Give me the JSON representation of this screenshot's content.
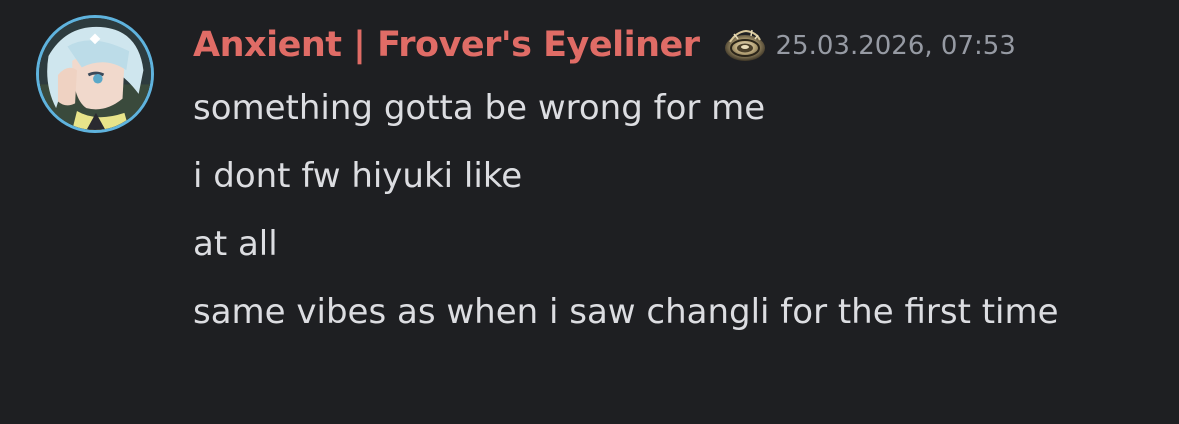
{
  "message": {
    "author": "Anxient | Frover's Eyeliner",
    "author_color": "#e06c66",
    "badge_icon": "ornate-bronze-disc-icon",
    "timestamp": "25.03.2026, 07:53",
    "lines": [
      "something gotta be wrong for me",
      "i dont fw hiyuki like",
      "at all",
      "same vibes as when i saw changli for the first time"
    ]
  },
  "colors": {
    "background": "#1e1f22",
    "text": "#dcdde1",
    "timestamp": "#969aa3",
    "avatar_ring": "#5fb3de"
  }
}
